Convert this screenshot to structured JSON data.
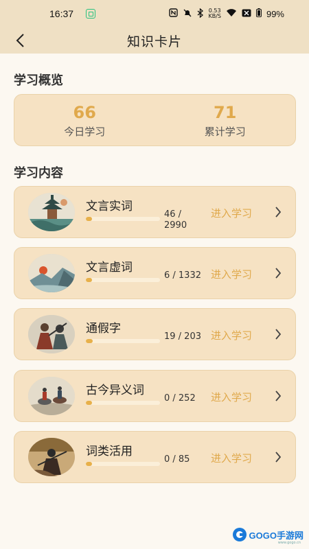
{
  "status_bar": {
    "time": "16:37",
    "speed_value": "0.53",
    "speed_unit": "KB/S",
    "battery": "99%"
  },
  "header": {
    "title": "知识卡片",
    "back_icon": "chevron-left-icon"
  },
  "overview": {
    "title": "学习概览",
    "today": {
      "value": "66",
      "label": "今日学习"
    },
    "total": {
      "value": "71",
      "label": "累计学习"
    },
    "accent_color": "#e0a94c"
  },
  "content": {
    "title": "学习内容",
    "enter_label": "进入学习",
    "items": [
      {
        "name": "文言实词",
        "progress_text": "46 / 2990",
        "progress": 0.0154,
        "thumbnail": "pavilion-painting"
      },
      {
        "name": "文言虚词",
        "progress_text": "6 / 1332",
        "progress": 0.0045,
        "thumbnail": "sunset-landscape-painting"
      },
      {
        "name": "通假字",
        "progress_text": "19 / 203",
        "progress": 0.0936,
        "thumbnail": "warriors-painting"
      },
      {
        "name": "古今异义词",
        "progress_text": "0 / 252",
        "progress": 0,
        "thumbnail": "horsemen-painting"
      },
      {
        "name": "词类活用",
        "progress_text": "0 / 85",
        "progress": 0,
        "thumbnail": "battle-painting"
      }
    ]
  },
  "watermark": {
    "text": "GOGO手游网",
    "sub": "www.gogo.cn"
  }
}
